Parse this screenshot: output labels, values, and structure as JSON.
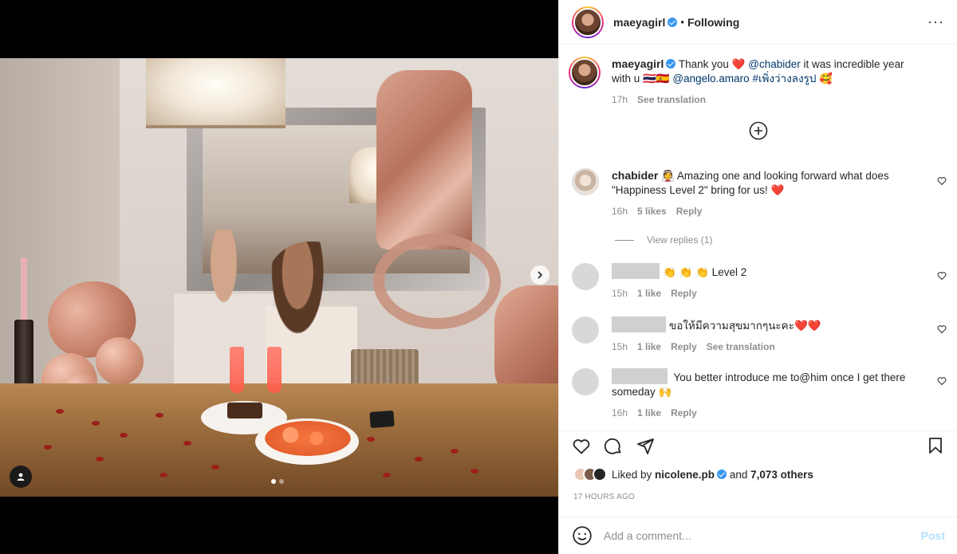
{
  "post": {
    "username": "maeyagirl",
    "follow_status": "Following",
    "separator": "•",
    "more_icon": "more-dots-icon"
  },
  "caption": {
    "username": "maeyagirl",
    "text_1": "Thank you ",
    "heart": "❤️",
    "mention_1": "@chabider",
    "text_2": " it was incredible year with u ",
    "symbols": "🇹🇭🇪🇸 ",
    "mention_2": "@angelo.amaro",
    "text_3": " ",
    "hashtag": "#เพิ่งว่างลงรูป",
    "text_4": " 🥰",
    "time": "17h",
    "see_translation": "See translation"
  },
  "comments": [
    {
      "username": "chabider",
      "text": " 👰 Amazing one and looking forward what does \"Happiness Level 2\" bring for us! ❤️",
      "time": "16h",
      "likes": "5 likes",
      "reply": "Reply",
      "view_replies": "View replies (1)"
    },
    {
      "username": "",
      "text": "👏 👏 👏 Level 2",
      "time": "15h",
      "likes": "1 like",
      "reply": "Reply"
    },
    {
      "username": "",
      "text": "ขอให้มีความสุขมากๆนะคะ❤️❤️",
      "time": "15h",
      "likes": "1 like",
      "reply": "Reply",
      "see_translation": "See translation"
    },
    {
      "username": "",
      "text": " You better introduce me to@him once I get there someday 🙌",
      "time": "16h",
      "likes": "1 like",
      "reply": "Reply"
    }
  ],
  "likes": {
    "prefix": "Liked by ",
    "user": "nicolene.pb",
    "suffix": " and ",
    "count": "7,073 others"
  },
  "timestamp": "17 HOURS AGO",
  "composer": {
    "placeholder": "Add a comment...",
    "post_label": "Post"
  },
  "carousel": {
    "current": 1,
    "total": 2
  },
  "colors": {
    "verified": "#3897f0",
    "mention": "#00376b",
    "muted": "#8e8e8e",
    "post_disabled": "#b2dffc"
  }
}
